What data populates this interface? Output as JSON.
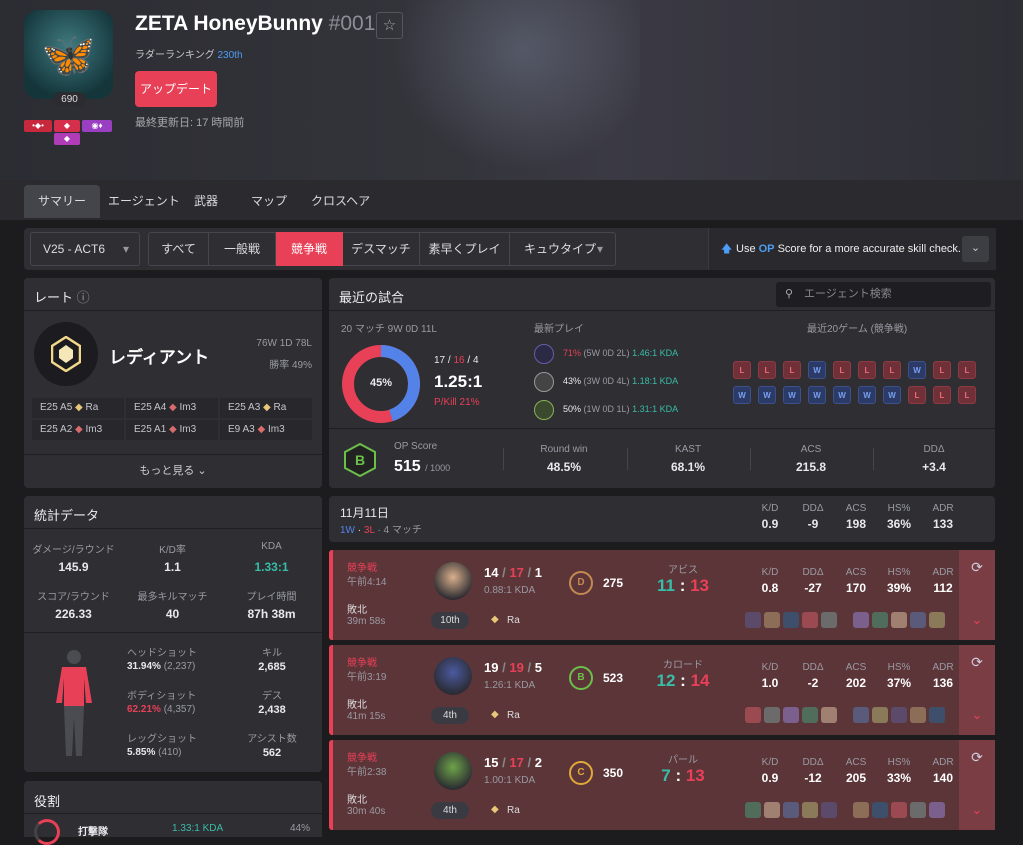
{
  "profile": {
    "name": "ZETA HoneyBunny",
    "tag": "#001",
    "ladder_prefix": "ラダーランキング",
    "ladder_rank": "230th",
    "update_label": "アップデート",
    "last_updated": "最終更新日: 17 時間前",
    "level": "690"
  },
  "nav_tabs": [
    "サマリー",
    "エージェント",
    "武器",
    "マップ",
    "クロスヘア"
  ],
  "filter": {
    "season": "V25 - ACT6",
    "modes": [
      "すべて",
      "一般戦",
      "競争戦",
      "デスマッチ",
      "素早くプレイ",
      "キュウタイプ"
    ],
    "active_mode": "競争戦",
    "op_note_pre": "Use ",
    "op_note_op": "OP",
    "op_note_post": " Score for a more accurate skill check."
  },
  "rating": {
    "title": "レート",
    "rank": "レディアント",
    "record": "76W 1D 78L",
    "winrate": "勝率 49%",
    "past": [
      [
        "E25 A5",
        "Ra"
      ],
      [
        "E25 A4",
        "Im3"
      ],
      [
        "E25 A3",
        "Ra"
      ],
      [
        "E25 A2",
        "Im3"
      ],
      [
        "E25 A1",
        "Im3"
      ],
      [
        "E9 A3",
        "Im3"
      ]
    ],
    "more": "もっと見る"
  },
  "stats": {
    "title": "統計データ",
    "items": [
      [
        "ダメージ/ラウンド",
        "145.9"
      ],
      [
        "K/D率",
        "1.1"
      ],
      [
        "KDA",
        "1.33:1"
      ],
      [
        "スコア/ラウンド",
        "226.33"
      ],
      [
        "最多キルマッチ",
        "40"
      ],
      [
        "プレイ時間",
        "87h 38m"
      ]
    ],
    "hit": [
      [
        "ヘッドショット",
        "31.94%",
        "(2,237)"
      ],
      [
        "ボディショット",
        "62.21%",
        "(4,357)"
      ],
      [
        "レッグショット",
        "5.85%",
        "(410)"
      ]
    ],
    "kda": [
      [
        "キル",
        "2,685"
      ],
      [
        "デス",
        "2,438"
      ],
      [
        "アシスト数",
        "562"
      ]
    ]
  },
  "role": {
    "title": "役割",
    "name": "打撃隊",
    "kda": "1.33:1 KDA",
    "pct": "44%"
  },
  "recent": {
    "title": "最近の試合",
    "search_placeholder": "エージェント検索",
    "summary": "20 マッチ 9W 0D 11L",
    "winpct": "45%",
    "k": "17",
    "d": "16",
    "a": "4",
    "kda": "1.25:1",
    "pkill": "P/Kill 21%",
    "latest_label": "最新プレイ",
    "agents": [
      [
        "71%",
        "(5W 0D 2L)",
        "1.46:1 KDA"
      ],
      [
        "43%",
        "(3W 0D 4L)",
        "1.18:1 KDA"
      ],
      [
        "50%",
        "(1W 0D 1L)",
        "1.31:1 KDA"
      ]
    ],
    "last20_label": "最近20ゲーム (競争戦)",
    "last20": [
      "L",
      "L",
      "L",
      "W",
      "L",
      "L",
      "L",
      "W",
      "L",
      "L",
      "W",
      "W",
      "W",
      "W",
      "W",
      "W",
      "W",
      "L",
      "L",
      "L"
    ],
    "op_label": "OP Score",
    "op_grade": "B",
    "op_score": "515",
    "op_max": "/ 1000",
    "metrics": [
      [
        "Round win",
        "48.5%"
      ],
      [
        "KAST",
        "68.1%"
      ],
      [
        "ACS",
        "215.8"
      ],
      [
        "DDΔ",
        "+3.4"
      ]
    ]
  },
  "day": {
    "date": "11月11日",
    "w": "1W",
    "l": "3L",
    "count": "· 4 マッチ",
    "heads": [
      "K/D",
      "DDΔ",
      "ACS",
      "HS%",
      "ADR"
    ],
    "vals": [
      "0.9",
      "-9",
      "198",
      "36%",
      "133"
    ]
  },
  "matches": [
    {
      "mode": "競争戦",
      "time": "午前4:14",
      "result": "敗北",
      "dur": "39m 58s",
      "k": "14",
      "d": "17",
      "a": "1",
      "kda": "0.88:1 KDA",
      "place": "10th",
      "rank": "Ra",
      "grade": "D",
      "score": "275",
      "map": "アビス",
      "sw": "11",
      "sl": "13",
      "vals": [
        "0.8",
        "-27",
        "170",
        "39%",
        "112"
      ]
    },
    {
      "mode": "競争戦",
      "time": "午前3:19",
      "result": "敗北",
      "dur": "41m 15s",
      "k": "19",
      "d": "19",
      "a": "5",
      "kda": "1.26:1 KDA",
      "place": "4th",
      "rank": "Ra",
      "grade": "B",
      "score": "523",
      "map": "カロード",
      "sw": "12",
      "sl": "14",
      "vals": [
        "1.0",
        "-2",
        "202",
        "37%",
        "136"
      ]
    },
    {
      "mode": "競争戦",
      "time": "午前2:38",
      "result": "敗北",
      "dur": "30m 40s",
      "k": "15",
      "d": "17",
      "a": "2",
      "kda": "1.00:1 KDA",
      "place": "4th",
      "rank": "Ra",
      "grade": "C",
      "score": "350",
      "map": "パール",
      "sw": "7",
      "sl": "13",
      "vals": [
        "0.9",
        "-12",
        "205",
        "33%",
        "140"
      ]
    }
  ],
  "colors": {
    "accent": "#e84057",
    "blue": "#5383e8",
    "teal": "#38bda8"
  }
}
